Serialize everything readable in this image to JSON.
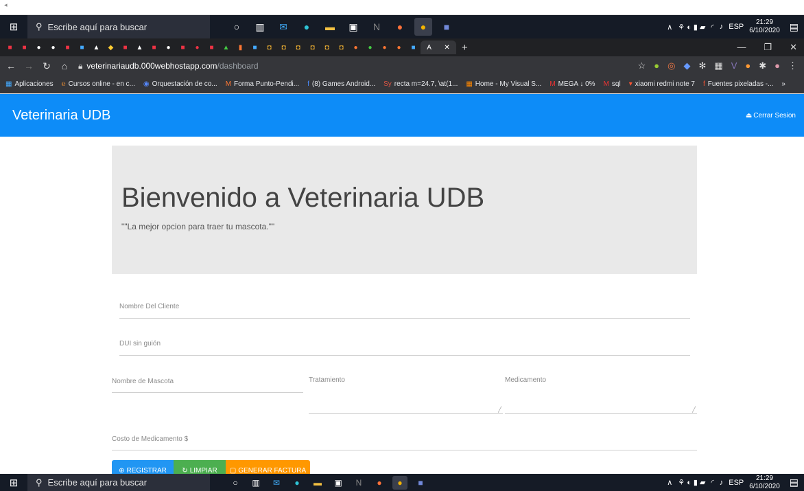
{
  "taskbar": {
    "search_placeholder": "Escribe aquí para buscar",
    "tray_lang": "ESP",
    "clock_time": "21:29",
    "clock_date": "6/10/2020"
  },
  "browser": {
    "url_host": "veterinariaudb.000webhostapp.com",
    "url_path": "/dashboard",
    "active_tab_label": "A",
    "bookmarks": [
      {
        "label": "Aplicaciones"
      },
      {
        "label": "Cursos online - en c..."
      },
      {
        "label": "Orquestación de co..."
      },
      {
        "label": "Forma Punto-Pendi..."
      },
      {
        "label": "(8) Games Android..."
      },
      {
        "label": "recta m=24.7, \\at(1..."
      },
      {
        "label": "Home - My Visual S..."
      },
      {
        "label": "MEGA ↓ 0%"
      },
      {
        "label": "sql"
      },
      {
        "label": "xiaomi redmi note 7"
      },
      {
        "label": "Fuentes pixeladas -..."
      }
    ]
  },
  "app": {
    "brand": "Veterinaria UDB",
    "logout": "Cerrar Sesion",
    "heading": "Bienvenido a Veterinaria UDB",
    "tagline": "\"\"La mejor opcion para traer tu mascota.\"\"",
    "fields": {
      "nombre_cliente": "Nombre Del Cliente",
      "dui": "DUI sin guión",
      "nombre_mascota": "Nombre de Mascota",
      "tratamiento": "Tratamiento",
      "medicamento": "Medicamento",
      "costo": "Costo de Medicamento $"
    },
    "buttons": {
      "registrar": "REGISTRAR",
      "limpiar": "LIMPIAR",
      "factura": "GENERAR FACTURA"
    }
  },
  "colors": {
    "navbar": "#0d8cf8",
    "registrar": "#2196f3",
    "limpiar": "#4caf50",
    "factura": "#ff9800"
  }
}
